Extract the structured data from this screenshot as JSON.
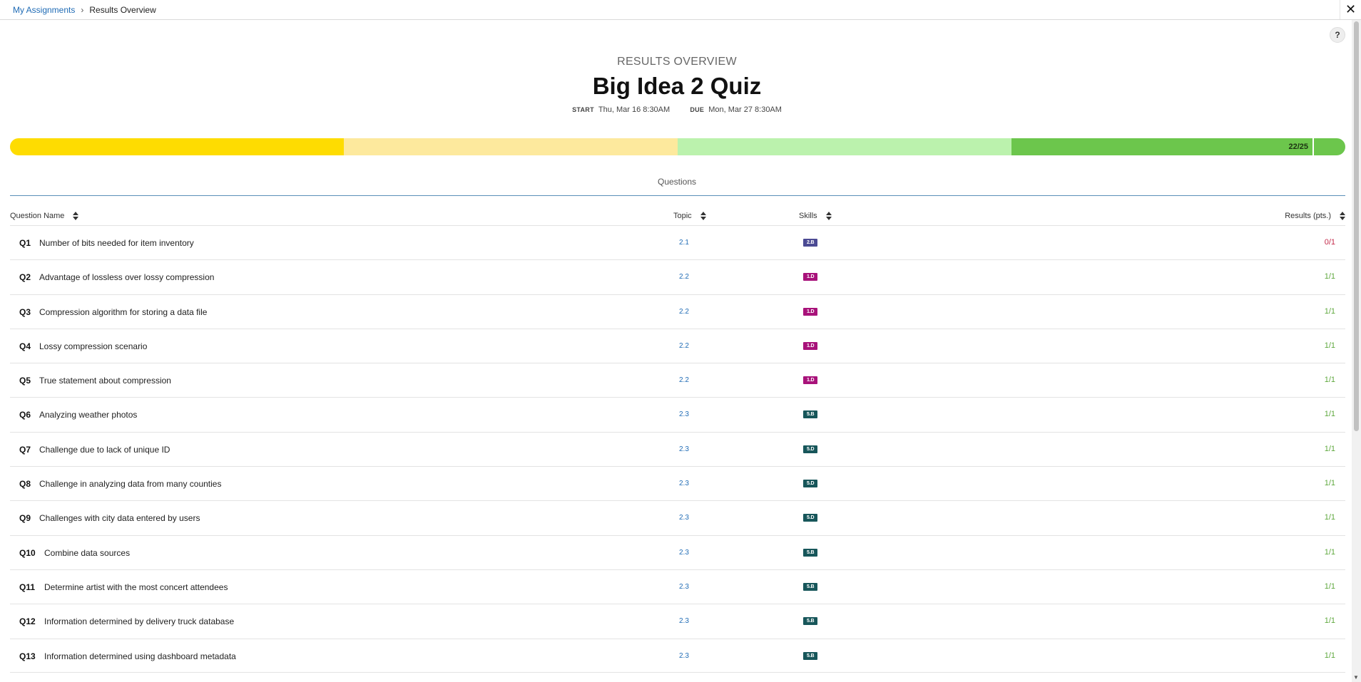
{
  "breadcrumb": {
    "parent": "My Assignments",
    "separator": "›",
    "current": "Results Overview"
  },
  "close_label": "✕",
  "help_label": "?",
  "header": {
    "eyebrow": "RESULTS OVERVIEW",
    "title": "Big Idea 2 Quiz",
    "start_label": "START",
    "start_value": "Thu, Mar 16 8:30AM",
    "due_label": "DUE",
    "due_value": "Mon, Mar 27 8:30AM"
  },
  "progress": {
    "score_label": "22/25",
    "score_fraction": 0.88,
    "colors": [
      "#fedc01",
      "#fde99d",
      "#bbf2ad",
      "#6cc64c"
    ]
  },
  "section_label": "Questions",
  "columns": {
    "name": "Question Name",
    "topic": "Topic",
    "skills": "Skills",
    "results": "Results (pts.)"
  },
  "skill_colors": {
    "2.B": "#4b4a93",
    "1.D": "#a8127a",
    "5.B": "#17565a",
    "5.D": "#17565a"
  },
  "result_colors": {
    "correct": "#5ea83d",
    "incorrect": "#c32a4a"
  },
  "questions": [
    {
      "num": "Q1",
      "name": "Number of bits needed for item inventory",
      "topic": "2.1",
      "skill": "2.B",
      "result": "0/1",
      "status": "incorrect"
    },
    {
      "num": "Q2",
      "name": "Advantage of lossless over lossy compression",
      "topic": "2.2",
      "skill": "1.D",
      "result": "1/1",
      "status": "correct"
    },
    {
      "num": "Q3",
      "name": "Compression algorithm for storing a data file",
      "topic": "2.2",
      "skill": "1.D",
      "result": "1/1",
      "status": "correct"
    },
    {
      "num": "Q4",
      "name": "Lossy compression scenario",
      "topic": "2.2",
      "skill": "1.D",
      "result": "1/1",
      "status": "correct"
    },
    {
      "num": "Q5",
      "name": "True statement about compression",
      "topic": "2.2",
      "skill": "1.D",
      "result": "1/1",
      "status": "correct"
    },
    {
      "num": "Q6",
      "name": "Analyzing weather photos",
      "topic": "2.3",
      "skill": "5.B",
      "result": "1/1",
      "status": "correct"
    },
    {
      "num": "Q7",
      "name": "Challenge due to lack of unique ID",
      "topic": "2.3",
      "skill": "5.D",
      "result": "1/1",
      "status": "correct"
    },
    {
      "num": "Q8",
      "name": "Challenge in analyzing data from many counties",
      "topic": "2.3",
      "skill": "5.D",
      "result": "1/1",
      "status": "correct"
    },
    {
      "num": "Q9",
      "name": "Challenges with city data entered by users",
      "topic": "2.3",
      "skill": "5.D",
      "result": "1/1",
      "status": "correct"
    },
    {
      "num": "Q10",
      "name": "Combine data sources",
      "topic": "2.3",
      "skill": "5.B",
      "result": "1/1",
      "status": "correct"
    },
    {
      "num": "Q11",
      "name": "Determine artist with the most concert attendees",
      "topic": "2.3",
      "skill": "5.B",
      "result": "1/1",
      "status": "correct"
    },
    {
      "num": "Q12",
      "name": "Information determined by delivery truck database",
      "topic": "2.3",
      "skill": "5.B",
      "result": "1/1",
      "status": "correct"
    },
    {
      "num": "Q13",
      "name": "Information determined using dashboard metadata",
      "topic": "2.3",
      "skill": "5.B",
      "result": "1/1",
      "status": "correct"
    }
  ]
}
